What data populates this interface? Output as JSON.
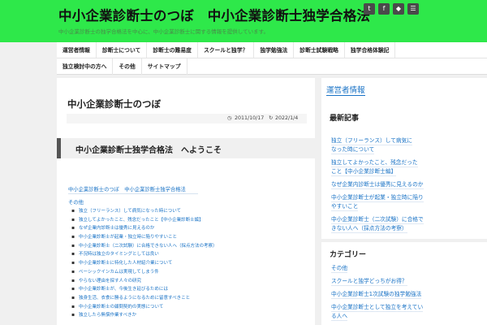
{
  "header": {
    "title": "中小企業診断士のつぼ　中小企業診断士独学合格法",
    "tagline": "中小企業診断士の独学合格法を中心に、中小企業診断士に関する情報を提供しています。",
    "social": [
      "twitter-icon",
      "facebook-icon",
      "feedly-icon",
      "rss-icon"
    ]
  },
  "nav": {
    "row1": [
      "運営者情報",
      "診断士について",
      "診断士の難易度",
      "スクールと独学？",
      "独学勉強法",
      "診断士試験戦略",
      "独学合格体験記"
    ],
    "row2": [
      "独立検討中の方へ",
      "その他",
      "サイトマップ"
    ]
  },
  "post": {
    "title": "中小企業診断士のつぼ",
    "date_posted": "2011/10/17",
    "date_updated": "2022/1/4",
    "heading": "中小企業診断士独学合格法　へようこそ",
    "breadcrumb": "中小企業診断士のつぼ　中小企業診断士独学合格法",
    "category": "その他",
    "list": [
      "独立（フリーランス）して病気になった時について",
      "独立してよかったこと、残念だったこと【中小企業診断士編】",
      "なぜ企業内診断士は優秀に見えるのか",
      "中小企業診断士が起業・独立時に陥りやすいこと",
      "中小企業診断士（二次試験）に合格できない人へ（採点方法の考察）",
      "不況時は独立のタイミングとしては良い",
      "中小企業診断士に特化した人材紹介業について",
      "ベーシックインカムは実現してしまう件",
      "やらない理由を探す人々の研究",
      "中小企業診断士が、今後生き延びるためには",
      "独身生活、衣食に勝るようになるために留意すべきこと",
      "中小企業診断士の顧問契約の実態について",
      "独立したら無償作業すべきか"
    ]
  },
  "sidebar": {
    "admin_label": "運営者情報",
    "recent_title": "最新記事",
    "recent": [
      [
        "独立（フリーランス）して病気に",
        "なった時について"
      ],
      [
        "独立してよかったこと、残念だった",
        "こと【中小企業診断士編】"
      ],
      [
        "なぜ企業内診断士は優秀に見えるのか"
      ],
      [
        "中小企業診断士が起業・独立時に陥り",
        "やすいこと"
      ],
      [
        "中小企業診断士（二次試験）に合格で",
        "きない人へ（採点方法の考察）"
      ]
    ],
    "category_title": "カテゴリー",
    "categories": [
      [
        "その他"
      ],
      [
        "スクールと独学どっちがお得？"
      ],
      [
        "中小企業診断士1次試験の独学勉強法"
      ],
      [
        "中小企業診断士として独立を考えてい",
        "る人へ"
      ]
    ]
  }
}
